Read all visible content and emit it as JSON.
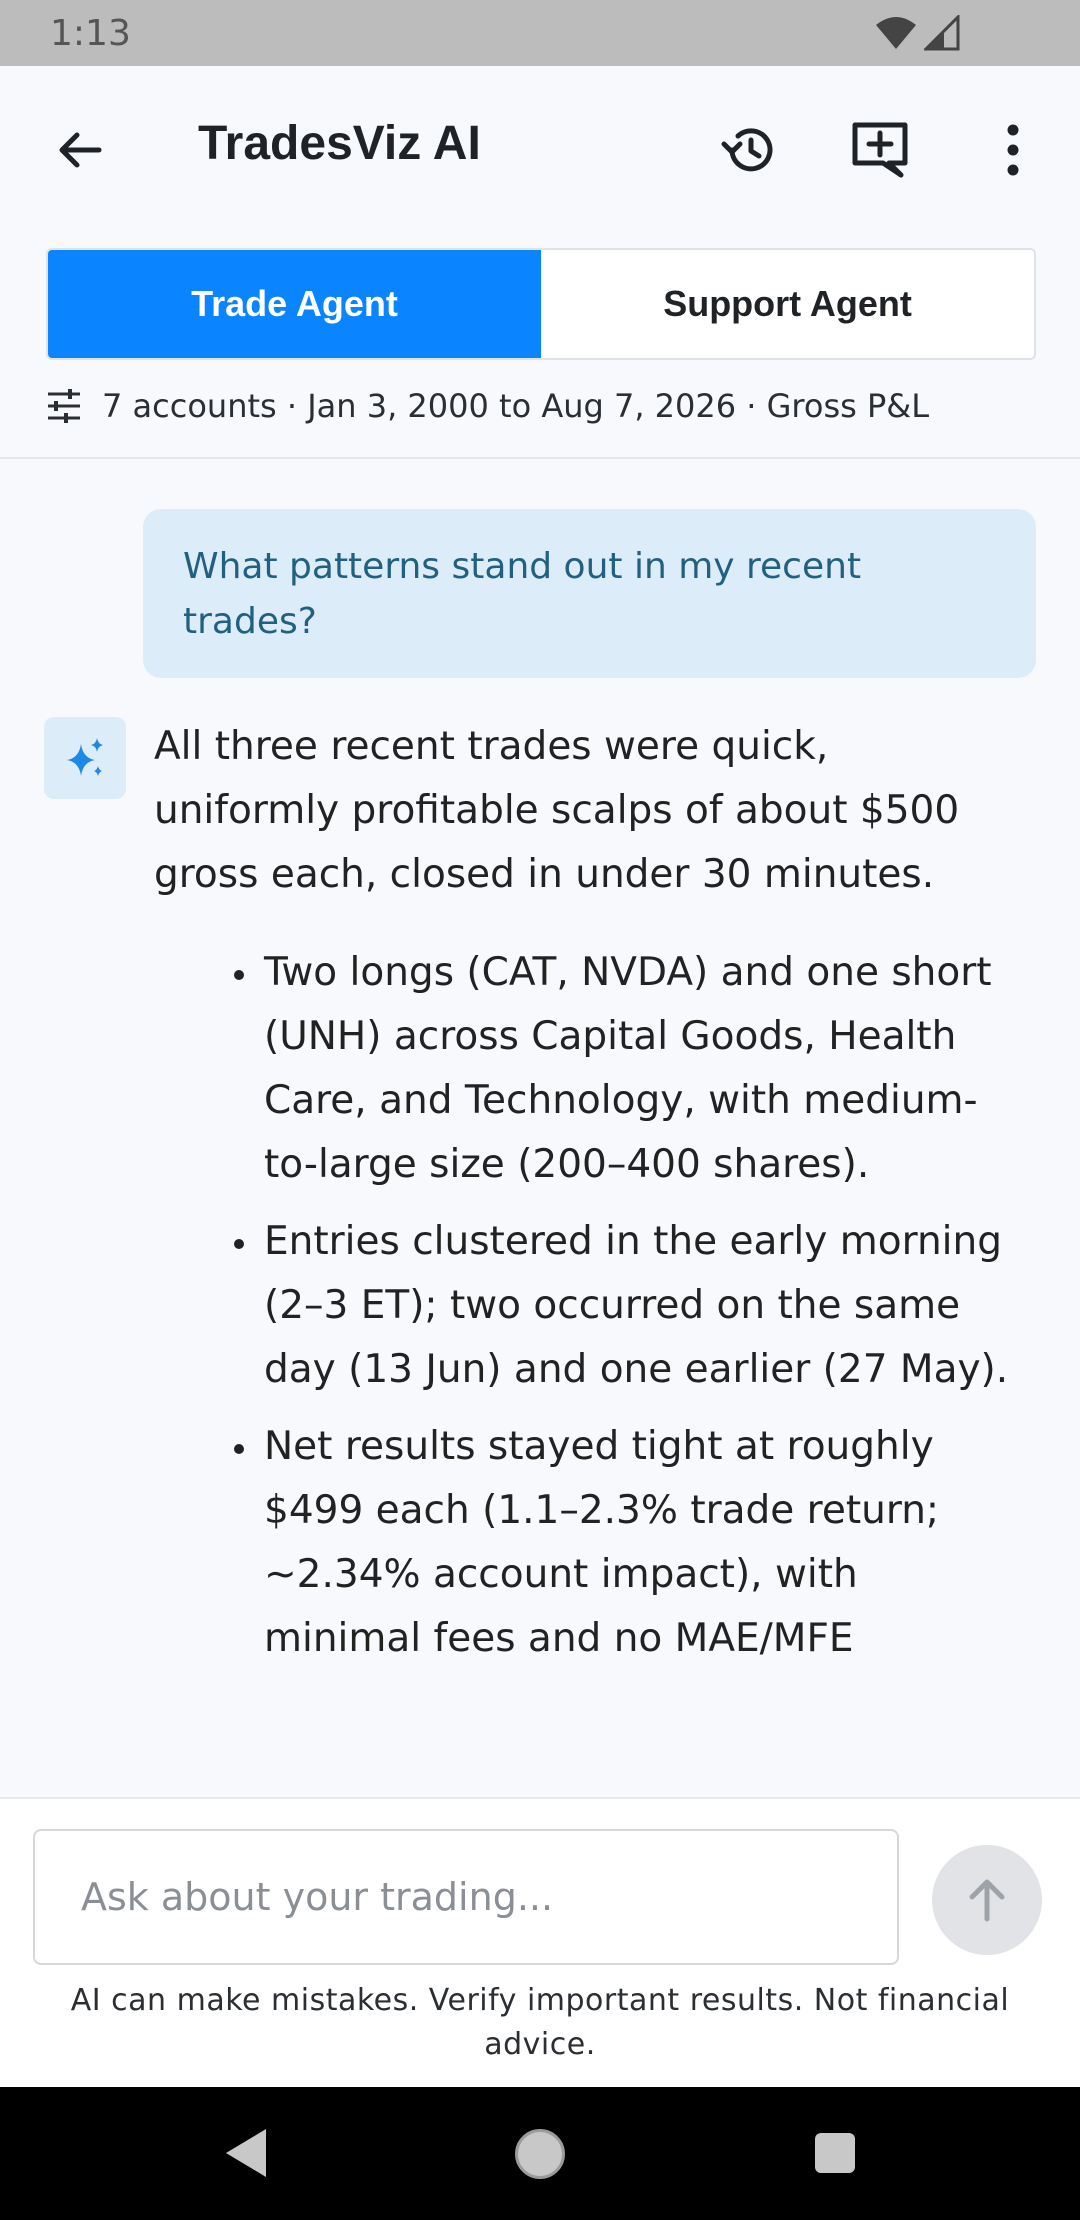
{
  "status_bar": {
    "time": "1:13"
  },
  "app_bar": {
    "title": "TradesViz AI",
    "icons": [
      "back-arrow-icon",
      "history-icon",
      "new-chat-icon",
      "more-vert-icon"
    ]
  },
  "tabs": [
    {
      "label": "Trade Agent",
      "active": true
    },
    {
      "label": "Support Agent",
      "active": false
    }
  ],
  "filter": {
    "summary": "7 accounts · Jan 3, 2000 to Aug 7, 2026 · Gross P&L"
  },
  "chat": {
    "user_message": "What patterns stand out in my recent trades?",
    "ai_intro": "All three recent trades were quick, uniformly profitable scalps of about $500 gross each, closed in under 30 minutes.",
    "ai_bullets": [
      "Two longs (CAT, NVDA) and one short (UNH) across Capital Goods, Health Care, and Technology, with medium-to-large size (200–400 shares).",
      "Entries clustered in the early morning (2–3 ET); two occurred on the same day (13 Jun) and one earlier (27 May).",
      "Net results stayed tight at roughly $499 each (1.1–2.3% trade return; ~2.34% account impact), with minimal fees and no MAE/MFE"
    ]
  },
  "composer": {
    "placeholder": "Ask about your trading...",
    "disclaimer": "AI can make mistakes. Verify important results. Not financial advice."
  },
  "colors": {
    "accent": "#0a84ff",
    "user_bubble": "#dcedf9",
    "user_text": "#22607f"
  }
}
